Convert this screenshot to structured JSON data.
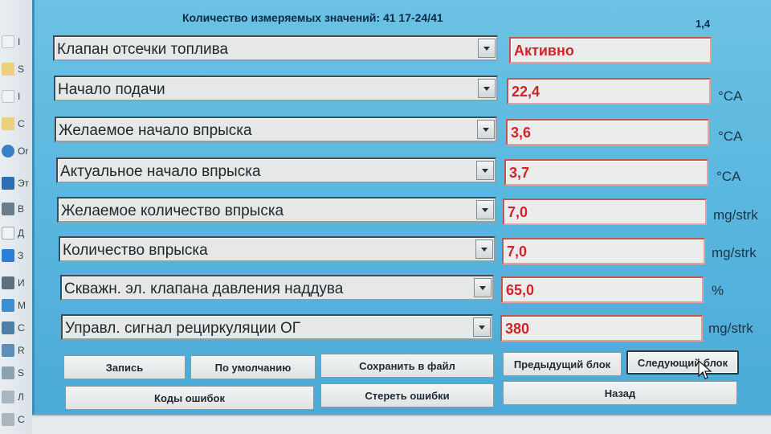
{
  "header": {
    "title": "Количество измеряемых значений: 41  17-24/41",
    "corner_label": "1,4"
  },
  "params": [
    {
      "label": "Клапан отсечки топлива",
      "value": "Активно",
      "unit": ""
    },
    {
      "label": "Начало подачи",
      "value": "22,4",
      "unit": "°CA"
    },
    {
      "label": "Желаемое начало впрыска",
      "value": "3,6",
      "unit": "°CA"
    },
    {
      "label": "Актуальное начало впрыска",
      "value": "3,7",
      "unit": "°CA"
    },
    {
      "label": "Желаемое количество впрыска",
      "value": "7,0",
      "unit": "mg/strk"
    },
    {
      "label": "Количество впрыска",
      "value": "7,0",
      "unit": "mg/strk"
    },
    {
      "label": "Скважн. эл. клапана давления наддува",
      "value": "65,0",
      "unit": "%"
    },
    {
      "label": "Управл. сигнал рециркуляции ОГ",
      "value": "380",
      "unit": "mg/strk"
    }
  ],
  "buttons": {
    "record": "Запись",
    "defaults": "По умолчанию",
    "save_file": "Сохранить в файл",
    "prev_block": "Предыдущий блок",
    "next_block": "Следующий блок",
    "error_codes": "Коды ошибок",
    "clear_errors": "Стереть ошибки",
    "back": "Назад"
  },
  "desktop_items": [
    "I",
    "S",
    "I",
    "C",
    "Or",
    "Эт",
    "В",
    "Д",
    "З",
    "И",
    "М",
    "С",
    "R",
    "S",
    "Л",
    "С"
  ],
  "colors": {
    "window_bg": "#5ab7df",
    "value_text": "#d2232a",
    "value_border": "#c5544f"
  }
}
